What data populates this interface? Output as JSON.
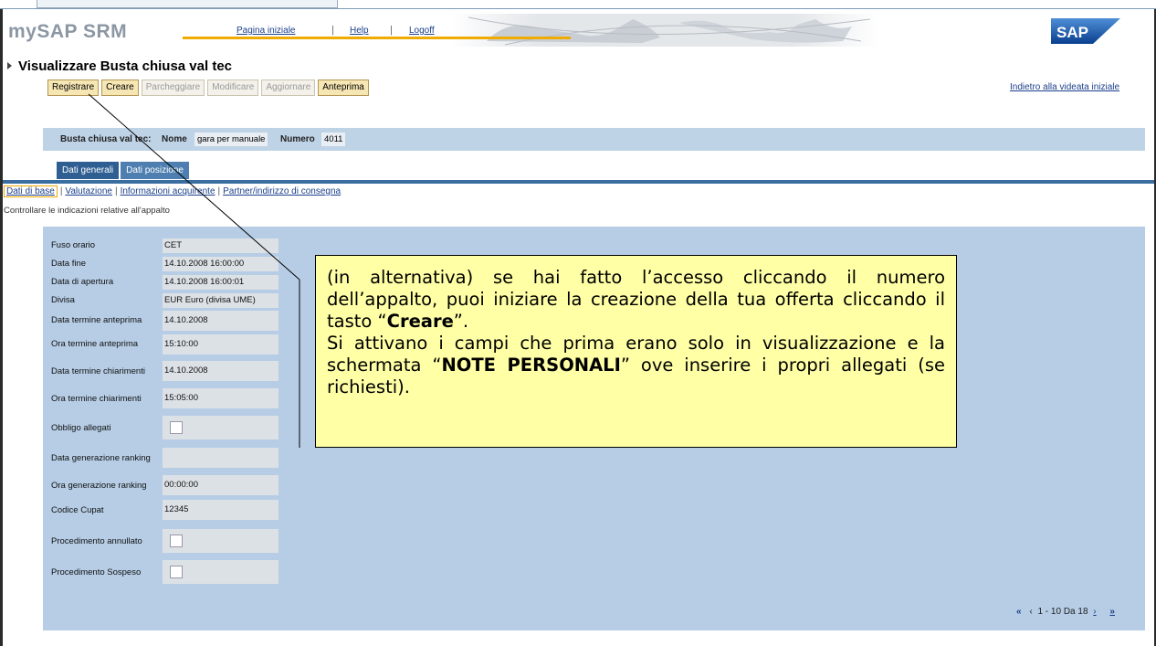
{
  "header": {
    "brand": "mySAP SRM",
    "nav": {
      "home": "Pagina iniziale",
      "help": "Help",
      "logoff": "Logoff",
      "separator": "|"
    },
    "logo_text": "SAP",
    "colors": {
      "accent": "#f0ab00",
      "link": "#1b3f8b",
      "panel": "#b6cde5"
    }
  },
  "page": {
    "title": "Visualizzare Busta chiusa val tec",
    "back_link": "Indietro alla videata iniziale"
  },
  "toolbar": {
    "buttons": [
      {
        "label": "Registrare",
        "enabled": true
      },
      {
        "label": "Creare",
        "enabled": true
      },
      {
        "label": "Parcheggiare",
        "enabled": false
      },
      {
        "label": "Modificare",
        "enabled": false
      },
      {
        "label": "Aggiornare",
        "enabled": false
      },
      {
        "label": "Anteprima",
        "enabled": true
      }
    ]
  },
  "document": {
    "type_label": "Busta chiusa val tec:",
    "name_label": "Nome",
    "name_value": "gara per manuale",
    "number_label": "Numero",
    "number_value": "4011"
  },
  "tabs": [
    {
      "label": "Dati generali",
      "selected": true
    },
    {
      "label": "Dati posizione",
      "selected": false
    }
  ],
  "subtabs": {
    "items": [
      {
        "label": "Dati di base",
        "selected": true
      },
      {
        "label": "Valutazione",
        "selected": false
      },
      {
        "label": "Informazioni acquirente",
        "selected": false
      },
      {
        "label": "Partner/indirizzo di consegna",
        "selected": false
      }
    ],
    "separator": "|"
  },
  "hint": "Controllare le indicazioni relative all'appalto",
  "fields": [
    {
      "label": "Fuso orario",
      "value": "CET"
    },
    {
      "label": "Data fine",
      "value": "14.10.2008  16:00:00"
    },
    {
      "label": "Data di apertura",
      "value": "14.10.2008 16:00:01"
    },
    {
      "label": "Divisa",
      "value": "EUR Euro (divisa UME)"
    },
    {
      "label": "Data termine anteprima",
      "value": "14.10.2008"
    },
    {
      "label": "Ora termine anteprima",
      "value": "15:10:00"
    },
    {
      "label": "Data termine chiarimenti",
      "value": "14.10.2008"
    },
    {
      "label": "Ora termine chiarimenti",
      "value": "15:05:00"
    },
    {
      "label": "Obbligo allegati",
      "checked": false
    },
    {
      "label": "Data generazione ranking",
      "value": ""
    },
    {
      "label": "Ora generazione ranking",
      "value": "00:00:00"
    },
    {
      "label": "Codice Cupat",
      "value": "12345"
    },
    {
      "label": "Procedimento annullato",
      "checked": false
    },
    {
      "label": "Procedimento Sospeso",
      "checked": false
    }
  ],
  "pager": {
    "first": "«",
    "prev": "‹",
    "range": "1 - 10 Da 18",
    "next": "›",
    "last": "»"
  },
  "callout": {
    "line1": "(in alternativa) se hai fatto l’accesso cliccando il numero dell’appalto, puoi iniziare la creazione della tua offerta cliccando il tasto “",
    "bold1": "Creare",
    "line1_end": "”.",
    "line2": "Si attivano i campi che prima erano solo in visualizzazione e la schermata “",
    "bold2": "NOTE PERSONALI",
    "line2_end": "” ove inserire i propri allegati (se richiesti)."
  }
}
